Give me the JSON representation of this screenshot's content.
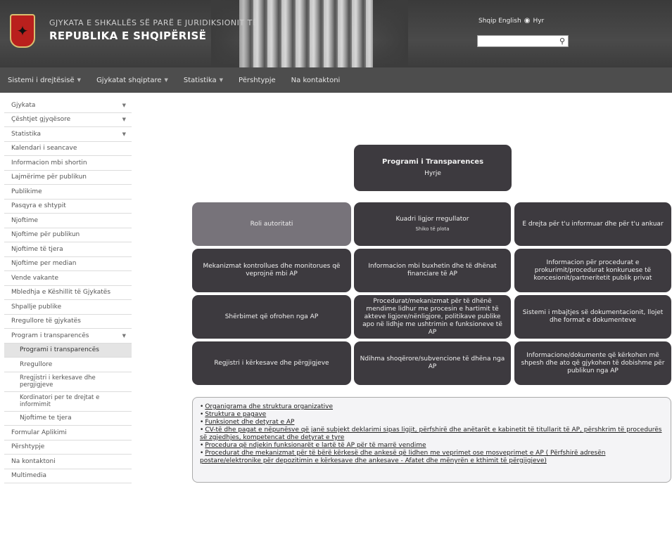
{
  "header": {
    "subtitle": "GJYKATA E SHKALLËS SË PARË E JURIDIKSIONIT TË",
    "title": "REPUBLIKA E SHQIPËRISË",
    "lang_links": "Shqip  English",
    "login_label": "Hyr",
    "search_placeholder": ""
  },
  "nav": [
    "Sistemi i drejtësisë",
    "Gjykatat shqiptare",
    "Statistika",
    "Përshtypje",
    "Na kontaktoni"
  ],
  "sidebar": [
    {
      "label": "Gjykata",
      "caret": true
    },
    {
      "label": "Çështjet gjyqësore",
      "caret": true
    },
    {
      "label": "Statistika",
      "caret": true
    },
    {
      "label": "Kalendari i seancave"
    },
    {
      "label": "Informacion mbi shortin"
    },
    {
      "label": "Lajmërime për publikun"
    },
    {
      "label": "Publikime"
    },
    {
      "label": "Pasqyra e shtypit"
    },
    {
      "label": "Njoftime"
    },
    {
      "label": "Njoftime për publikun"
    },
    {
      "label": "Njoftime të tjera"
    },
    {
      "label": "Njoftime per median"
    },
    {
      "label": "Vende vakante"
    },
    {
      "label": "Mbledhja e Këshillit të Gjykatës"
    },
    {
      "label": "Shpallje publike"
    },
    {
      "label": "Rregullore të gjykatës"
    },
    {
      "label": "Program i transparencës",
      "caret": true
    },
    {
      "label": "Programi i transparencës",
      "sub": true,
      "active": true
    },
    {
      "label": "Rregullore",
      "sub": true
    },
    {
      "label": "Rregjistri i kerkesave dhe pergjigjeve",
      "sub": true,
      "tall": true
    },
    {
      "label": "Kordinatori per te drejtat e informimit",
      "sub": true,
      "tall": true
    },
    {
      "label": "Njoftime te tjera",
      "sub": true
    },
    {
      "label": "Formular Aplikimi"
    },
    {
      "label": "Përshtypje"
    },
    {
      "label": "Na kontaktoni"
    },
    {
      "label": "Multimedia"
    }
  ],
  "diagram": {
    "top_title": "Programi i Transparences",
    "top_sub": "Hyrje",
    "grid": [
      [
        {
          "text": "Roli autoritati",
          "light": true
        },
        {
          "text": "Kuadri ligjor rregullator",
          "small": "Shiko të plota"
        },
        {
          "text": "E drejta për t'u informuar dhe për t'u ankuar"
        }
      ],
      [
        {
          "text": "Mekanizmat kontrollues dhe monitorues që veprojnë mbi AP"
        },
        {
          "text": "Informacion mbi buxhetin dhe të dhënat financiare të AP"
        },
        {
          "text": "Informacion për procedurat e prokurimit/procedurat konkuruese të koncesionit/partneritetit publik privat"
        }
      ],
      [
        {
          "text": "Shërbimet që ofrohen nga AP"
        },
        {
          "text": "Procedurat/mekanizmat për të dhënë mendime lidhur me procesin e hartimit të akteve ligjore/nënligjore, politikave publike apo në lidhje me ushtrimin e funksioneve të AP"
        },
        {
          "text": "Sistemi i mbajtjes së dokumentacionit, llojet dhe format e dokumenteve"
        }
      ],
      [
        {
          "text": "Regjistri i kërkesave dhe përgjigjeve"
        },
        {
          "text": "Ndihma shoqërore/subvencione të dhëna nga AP"
        },
        {
          "text": "Informacione/dokumente që kërkohen më shpesh dhe ato që gjykohen të dobishme për publikun nga AP"
        }
      ]
    ]
  },
  "links": [
    "Organigrama dhe struktura organizative",
    "Struktura e pagave",
    "Funksionet dhe detyrat e AP",
    "CV-të dhe pagat e nëpunësve që janë subjekt deklarimi sipas ligjit, përfshirë dhe anëtarët e kabinetit të titullarit të AP, përshkrim të procedurës së zgjedhjes, kompetencat dhe detyrat e tyre",
    "Procedura që ndjekin funksionarët e lartë të AP për të marrë vendime",
    "Procedurat dhe mekanizmat për të bërë kërkesë dhe ankesë që lidhen me veprimet ose mosveprimet e AP ( Përfshirë adresën postare/elektronike për depozitimin e kërkesave dhe ankesave - Afatet dhe mënyrën e kthimit të përgjigjeve)"
  ],
  "colors": {
    "box_dark": "#3d3a3f",
    "box_light": "#77737a",
    "nav_bg": "#4d4d4d"
  }
}
